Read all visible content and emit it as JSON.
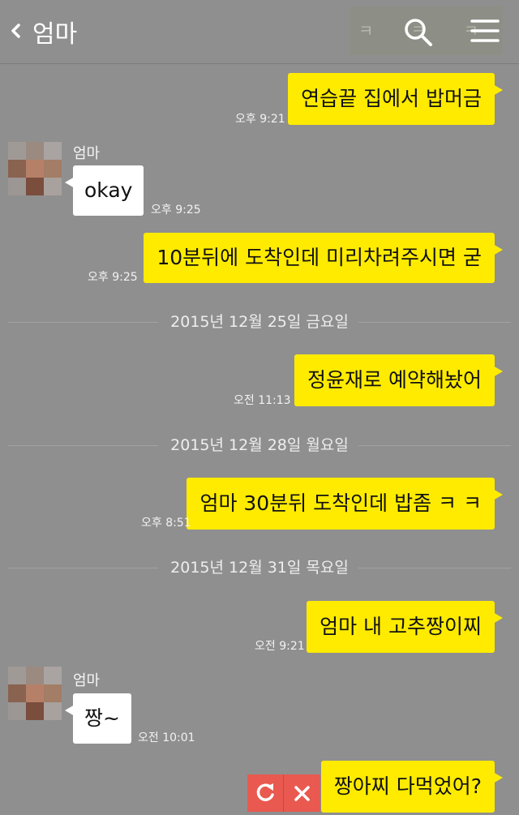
{
  "header": {
    "title": "엄마",
    "overlay_text": "ㅋ ㅋ ㅋ ㅋ"
  },
  "messages": [
    {
      "side": "mine",
      "text": "연습끝 집에서 밥머금",
      "time": "오후 9:21"
    },
    {
      "side": "theirs",
      "sender": "엄마",
      "text": "okay",
      "time": "오후 9:25"
    },
    {
      "side": "mine",
      "text": "10분뒤에 도착인데 미리차려주시면 굳",
      "time": "오후 9:25"
    },
    {
      "type": "date",
      "text": "2015년 12월 25일 금요일"
    },
    {
      "side": "mine",
      "text": "정윤재로 예약해놨어",
      "time": "오전 11:13"
    },
    {
      "type": "date",
      "text": "2015년 12월 28일 월요일"
    },
    {
      "side": "mine",
      "text": "엄마 30분뒤 도착인데 밥좀 ㅋ ㅋ",
      "time": "오후 8:51"
    },
    {
      "type": "date",
      "text": "2015년 12월 31일 목요일"
    },
    {
      "side": "mine",
      "text": "엄마 내 고추짱이찌",
      "time": "오전 9:21"
    },
    {
      "side": "theirs",
      "sender": "엄마",
      "text": "짱~",
      "time": "오전 10:01"
    },
    {
      "side": "mine",
      "text": "짱아찌 다먹었어?",
      "status": "failed"
    }
  ],
  "colors": {
    "background": "#8f8f8f",
    "my_bubble": "#ffeb00",
    "their_bubble": "#ffffff",
    "error_button": "#e9594f"
  }
}
